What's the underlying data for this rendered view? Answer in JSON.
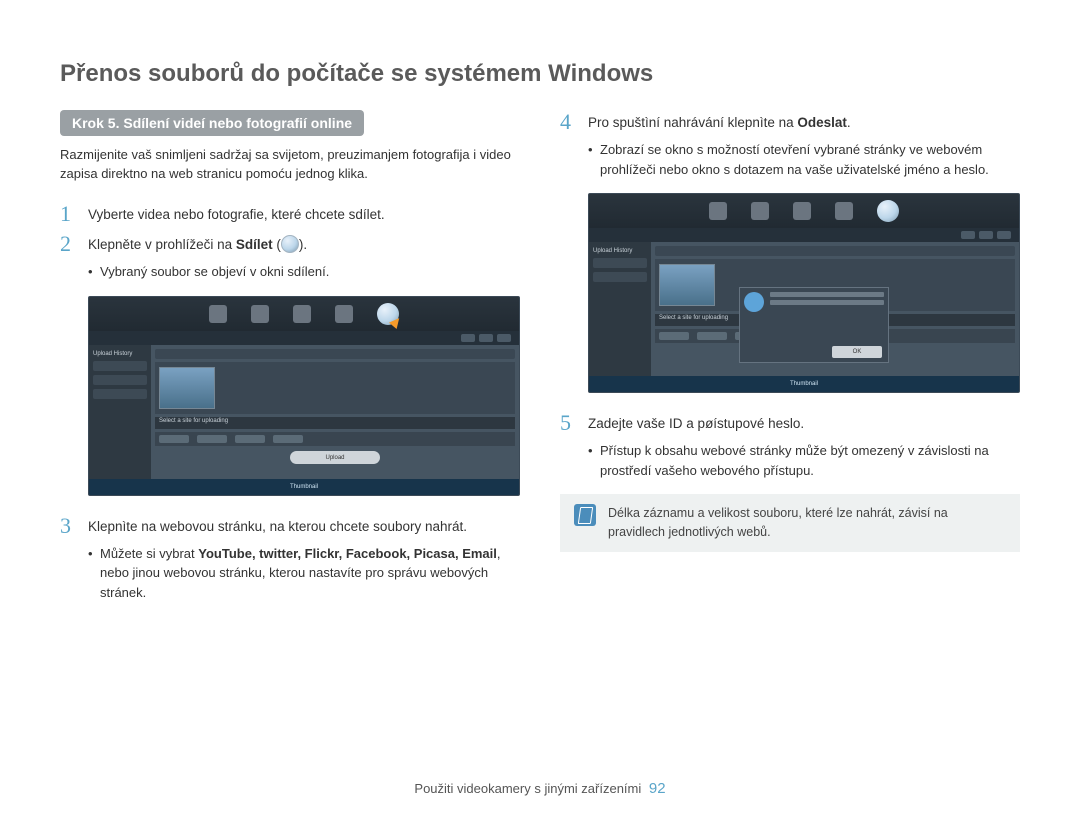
{
  "page_title": "Přenos souborů do počítače se systémem Windows",
  "step_banner": "Krok 5. Sdílení videí nebo fotografií online",
  "intro": "Razmijenite vaš snimljeni sadržaj sa svijetom, preuzimanjem fotografija i video zapisa direktno na web stranicu pomoću jednog klika.",
  "left_steps": {
    "s1": "Vyberte videa nebo fotografie, které chcete sdílet.",
    "s2_pre": "Klepněte v prohlížeči na ",
    "s2_bold": "Sdílet",
    "s2_post": " (",
    "s2_after_icon": ").",
    "s2_b1": "Vybraný soubor se objeví v okni sdílení.",
    "s3": "Klepnìte na webovou stránku, na kterou chcete soubory nahrát.",
    "s3_b1_pre": "Můžete si vybrat ",
    "s3_b1_list": "YouTube, twitter, Flickr, Facebook, Picasa, Email",
    "s3_b1_post": ", nebo jinou webovou stránku, kterou nastavíte pro správu webových stránek."
  },
  "right_steps": {
    "s4_pre": "Pro spuštìní nahrávání klepnìte na ",
    "s4_bold": "Odeslat",
    "s4_post": ".",
    "s4_b1": "Zobrazí se okno s možností otevření vybrané stránky ve webovém prohlížeči nebo okno s dotazem na vaše uživatelské jméno a heslo.",
    "s5": "Zadejte vaše ID a pøístupové heslo.",
    "s5_b1": "Přístup k obsahu webové stránky může být omezený v závislosti na prostředí vašeho webového přístupu."
  },
  "note": "Délka záznamu a velikost souboru, které lze nahrát, závisí na pravidlech jednotlivých webů.",
  "ui_mock": {
    "upload_btn": "Upload",
    "ok_btn": "OK",
    "select_label": "Select a site for uploading",
    "side_label": "Upload History",
    "thumb_bar": "Thumbnail"
  },
  "footer_text": "Použiti videokamery s jinými zařízeními",
  "page_number": "92"
}
